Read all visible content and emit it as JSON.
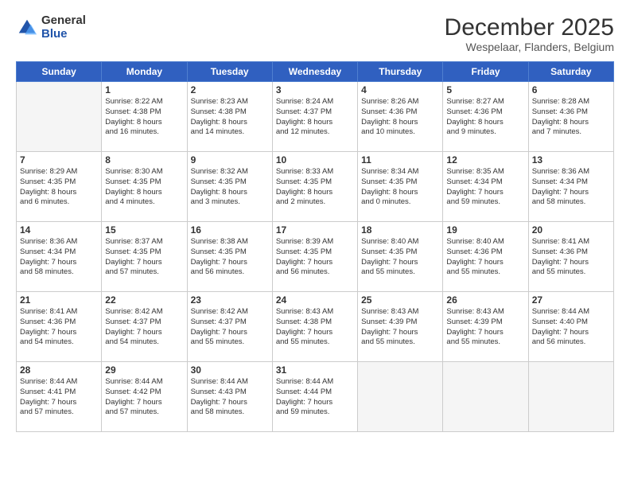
{
  "logo": {
    "general": "General",
    "blue": "Blue"
  },
  "header": {
    "title": "December 2025",
    "subtitle": "Wespelaar, Flanders, Belgium"
  },
  "weekdays": [
    "Sunday",
    "Monday",
    "Tuesday",
    "Wednesday",
    "Thursday",
    "Friday",
    "Saturday"
  ],
  "weeks": [
    [
      {
        "day": "",
        "info": ""
      },
      {
        "day": "1",
        "info": "Sunrise: 8:22 AM\nSunset: 4:38 PM\nDaylight: 8 hours\nand 16 minutes."
      },
      {
        "day": "2",
        "info": "Sunrise: 8:23 AM\nSunset: 4:38 PM\nDaylight: 8 hours\nand 14 minutes."
      },
      {
        "day": "3",
        "info": "Sunrise: 8:24 AM\nSunset: 4:37 PM\nDaylight: 8 hours\nand 12 minutes."
      },
      {
        "day": "4",
        "info": "Sunrise: 8:26 AM\nSunset: 4:36 PM\nDaylight: 8 hours\nand 10 minutes."
      },
      {
        "day": "5",
        "info": "Sunrise: 8:27 AM\nSunset: 4:36 PM\nDaylight: 8 hours\nand 9 minutes."
      },
      {
        "day": "6",
        "info": "Sunrise: 8:28 AM\nSunset: 4:36 PM\nDaylight: 8 hours\nand 7 minutes."
      }
    ],
    [
      {
        "day": "7",
        "info": "Sunrise: 8:29 AM\nSunset: 4:35 PM\nDaylight: 8 hours\nand 6 minutes."
      },
      {
        "day": "8",
        "info": "Sunrise: 8:30 AM\nSunset: 4:35 PM\nDaylight: 8 hours\nand 4 minutes."
      },
      {
        "day": "9",
        "info": "Sunrise: 8:32 AM\nSunset: 4:35 PM\nDaylight: 8 hours\nand 3 minutes."
      },
      {
        "day": "10",
        "info": "Sunrise: 8:33 AM\nSunset: 4:35 PM\nDaylight: 8 hours\nand 2 minutes."
      },
      {
        "day": "11",
        "info": "Sunrise: 8:34 AM\nSunset: 4:35 PM\nDaylight: 8 hours\nand 0 minutes."
      },
      {
        "day": "12",
        "info": "Sunrise: 8:35 AM\nSunset: 4:34 PM\nDaylight: 7 hours\nand 59 minutes."
      },
      {
        "day": "13",
        "info": "Sunrise: 8:36 AM\nSunset: 4:34 PM\nDaylight: 7 hours\nand 58 minutes."
      }
    ],
    [
      {
        "day": "14",
        "info": "Sunrise: 8:36 AM\nSunset: 4:34 PM\nDaylight: 7 hours\nand 58 minutes."
      },
      {
        "day": "15",
        "info": "Sunrise: 8:37 AM\nSunset: 4:35 PM\nDaylight: 7 hours\nand 57 minutes."
      },
      {
        "day": "16",
        "info": "Sunrise: 8:38 AM\nSunset: 4:35 PM\nDaylight: 7 hours\nand 56 minutes."
      },
      {
        "day": "17",
        "info": "Sunrise: 8:39 AM\nSunset: 4:35 PM\nDaylight: 7 hours\nand 56 minutes."
      },
      {
        "day": "18",
        "info": "Sunrise: 8:40 AM\nSunset: 4:35 PM\nDaylight: 7 hours\nand 55 minutes."
      },
      {
        "day": "19",
        "info": "Sunrise: 8:40 AM\nSunset: 4:36 PM\nDaylight: 7 hours\nand 55 minutes."
      },
      {
        "day": "20",
        "info": "Sunrise: 8:41 AM\nSunset: 4:36 PM\nDaylight: 7 hours\nand 55 minutes."
      }
    ],
    [
      {
        "day": "21",
        "info": "Sunrise: 8:41 AM\nSunset: 4:36 PM\nDaylight: 7 hours\nand 54 minutes."
      },
      {
        "day": "22",
        "info": "Sunrise: 8:42 AM\nSunset: 4:37 PM\nDaylight: 7 hours\nand 54 minutes."
      },
      {
        "day": "23",
        "info": "Sunrise: 8:42 AM\nSunset: 4:37 PM\nDaylight: 7 hours\nand 55 minutes."
      },
      {
        "day": "24",
        "info": "Sunrise: 8:43 AM\nSunset: 4:38 PM\nDaylight: 7 hours\nand 55 minutes."
      },
      {
        "day": "25",
        "info": "Sunrise: 8:43 AM\nSunset: 4:39 PM\nDaylight: 7 hours\nand 55 minutes."
      },
      {
        "day": "26",
        "info": "Sunrise: 8:43 AM\nSunset: 4:39 PM\nDaylight: 7 hours\nand 55 minutes."
      },
      {
        "day": "27",
        "info": "Sunrise: 8:44 AM\nSunset: 4:40 PM\nDaylight: 7 hours\nand 56 minutes."
      }
    ],
    [
      {
        "day": "28",
        "info": "Sunrise: 8:44 AM\nSunset: 4:41 PM\nDaylight: 7 hours\nand 57 minutes."
      },
      {
        "day": "29",
        "info": "Sunrise: 8:44 AM\nSunset: 4:42 PM\nDaylight: 7 hours\nand 57 minutes."
      },
      {
        "day": "30",
        "info": "Sunrise: 8:44 AM\nSunset: 4:43 PM\nDaylight: 7 hours\nand 58 minutes."
      },
      {
        "day": "31",
        "info": "Sunrise: 8:44 AM\nSunset: 4:44 PM\nDaylight: 7 hours\nand 59 minutes."
      },
      {
        "day": "",
        "info": ""
      },
      {
        "day": "",
        "info": ""
      },
      {
        "day": "",
        "info": ""
      }
    ]
  ]
}
